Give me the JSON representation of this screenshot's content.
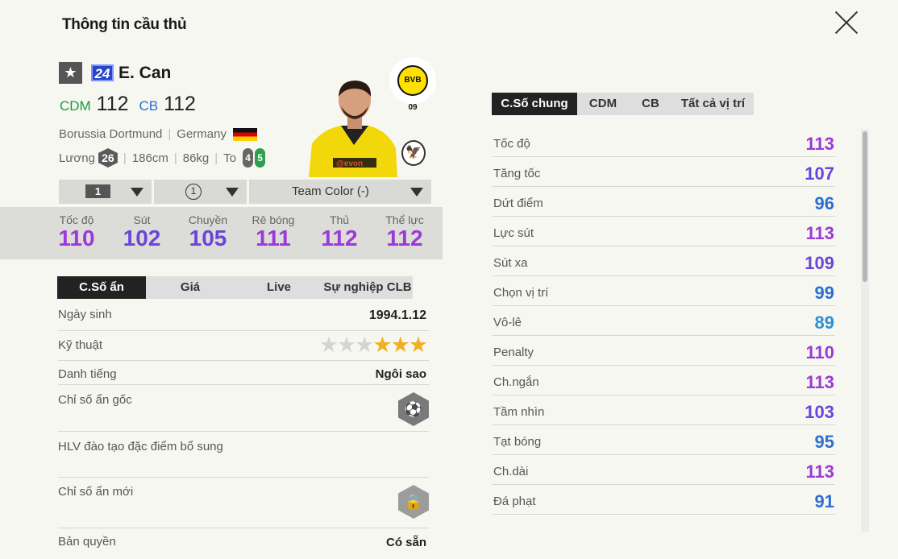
{
  "header": {
    "title": "Thông tin cầu thủ"
  },
  "player": {
    "star": "★",
    "number": "24",
    "name": "E. Can",
    "positions": [
      {
        "pos": "CDM",
        "ovr": "112"
      },
      {
        "pos": "CB",
        "ovr": "112"
      }
    ],
    "club": "Borussia Dortmund",
    "nation": "Germany",
    "salary_label": "Lương",
    "salary": "26",
    "height": "186cm",
    "weight": "86kg",
    "body": "To",
    "foot_left": "4",
    "foot_right": "5",
    "club_logo_text": "BVB 09"
  },
  "selectors": {
    "level": "1",
    "enhance": "1",
    "team_color": "Team Color (-)"
  },
  "stats": [
    {
      "label": "Tốc độ",
      "value": "110",
      "color": "#9b3ad6"
    },
    {
      "label": "Sút",
      "value": "102",
      "color": "#6a46d8"
    },
    {
      "label": "Chuyền",
      "value": "105",
      "color": "#6a46d8"
    },
    {
      "label": "Rê bóng",
      "value": "111",
      "color": "#9b3ad6"
    },
    {
      "label": "Thủ",
      "value": "112",
      "color": "#9b3ad6"
    },
    {
      "label": "Thể lực",
      "value": "112",
      "color": "#9b3ad6"
    }
  ],
  "left_tabs": [
    "C.Số ẩn",
    "Giá",
    "Live",
    "Sự nghiệp CLB"
  ],
  "details": {
    "birth_label": "Ngày sinh",
    "birth": "1994.1.12",
    "skill_label": "Kỹ thuật",
    "skill_stars": 3,
    "skill_max": 6,
    "reputation_label": "Danh tiếng",
    "reputation": "Ngôi sao",
    "hidden_label": "Chỉ số ẩn gốc",
    "coach_label": "HLV đào tạo đặc điểm bổ sung",
    "new_hidden_label": "Chỉ số ẩn mới",
    "license_label": "Bản quyền",
    "license": "Có sẵn"
  },
  "right_tabs": [
    "C.Số chung",
    "CDM",
    "CB",
    "Tất cả vị trí"
  ],
  "attributes": [
    {
      "label": "Tốc độ",
      "value": "113",
      "color": "#9b3ad6"
    },
    {
      "label": "Tăng tốc",
      "value": "107",
      "color": "#6a46d8"
    },
    {
      "label": "Dứt điểm",
      "value": "96",
      "color": "#2d6fd2"
    },
    {
      "label": "Lực sút",
      "value": "113",
      "color": "#9b3ad6"
    },
    {
      "label": "Sút xa",
      "value": "109",
      "color": "#6a46d8"
    },
    {
      "label": "Chọn vị trí",
      "value": "99",
      "color": "#2d6fd2"
    },
    {
      "label": "Vô-lê",
      "value": "89",
      "color": "#2d8fd0"
    },
    {
      "label": "Penalty",
      "value": "110",
      "color": "#9b3ad6"
    },
    {
      "label": "Ch.ngắn",
      "value": "113",
      "color": "#9b3ad6"
    },
    {
      "label": "Tầm nhìn",
      "value": "103",
      "color": "#6a46d8"
    },
    {
      "label": "Tạt bóng",
      "value": "95",
      "color": "#2d6fd2"
    },
    {
      "label": "Ch.dài",
      "value": "113",
      "color": "#9b3ad6"
    },
    {
      "label": "Đá phạt",
      "value": "91",
      "color": "#2d6fd2"
    }
  ]
}
